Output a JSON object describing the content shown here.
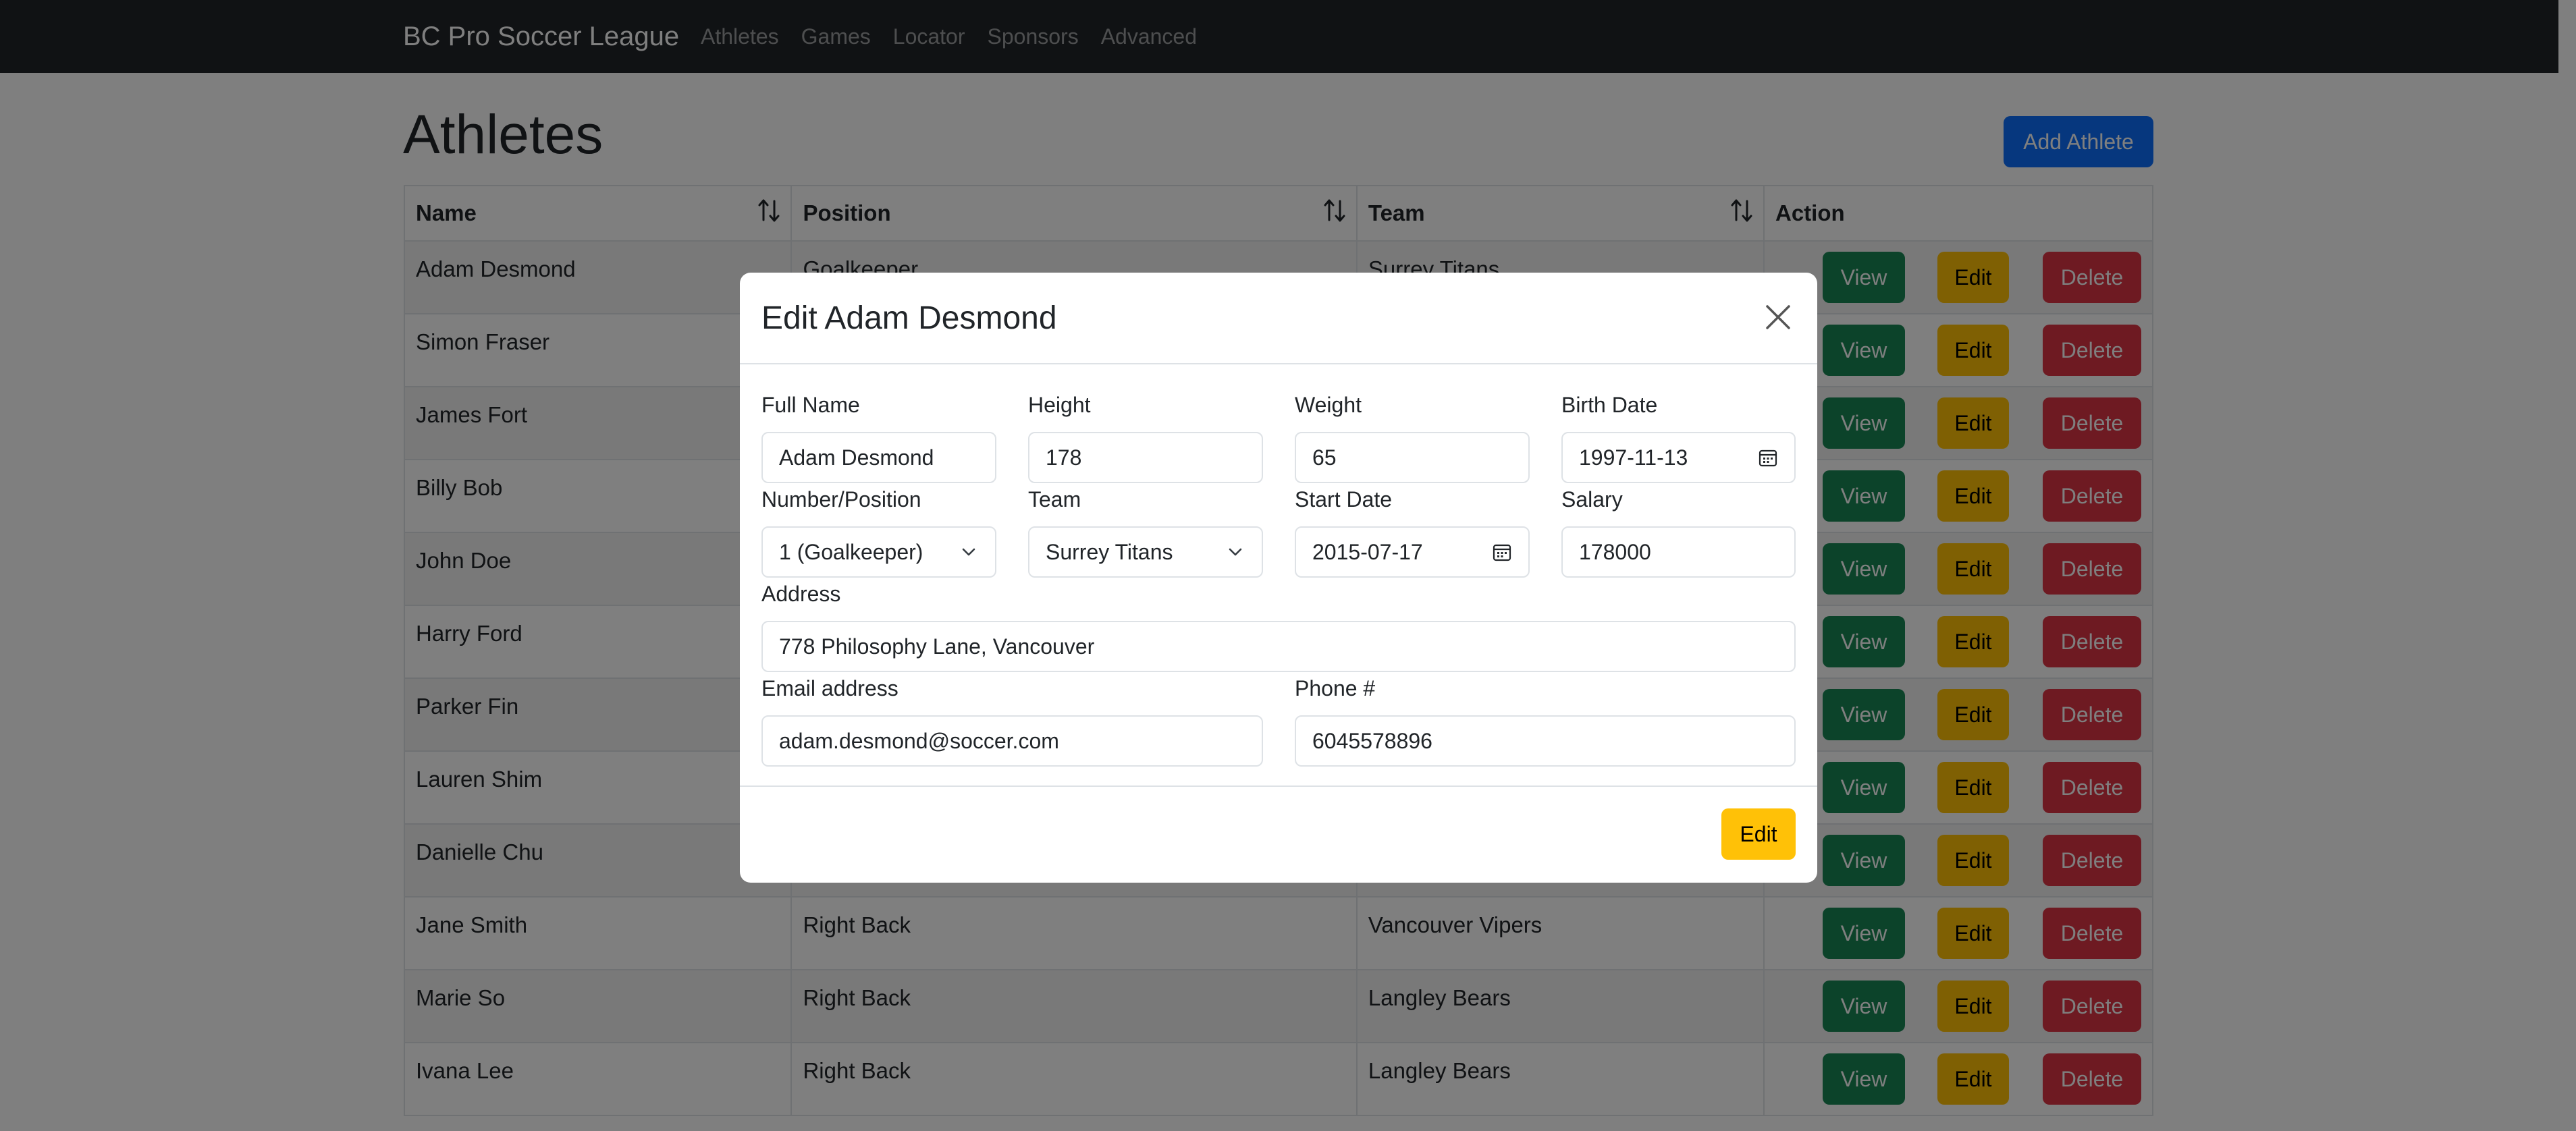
{
  "navbar": {
    "brand": "BC Pro Soccer League",
    "links": [
      "Athletes",
      "Games",
      "Locator",
      "Sponsors",
      "Advanced"
    ]
  },
  "page": {
    "title": "Athletes",
    "add_button": "Add Athlete"
  },
  "table": {
    "headers": [
      "Name",
      "Position",
      "Team",
      "Action"
    ],
    "action_labels": {
      "view": "View",
      "edit": "Edit",
      "delete": "Delete"
    },
    "rows": [
      {
        "name": "Adam Desmond",
        "position": "Goalkeeper",
        "team": "Surrey Titans"
      },
      {
        "name": "Simon Fraser",
        "position": "",
        "team": ""
      },
      {
        "name": "James Fort",
        "position": "",
        "team": ""
      },
      {
        "name": "Billy Bob",
        "position": "",
        "team": ""
      },
      {
        "name": "John Doe",
        "position": "",
        "team": ""
      },
      {
        "name": "Harry Ford",
        "position": "",
        "team": ""
      },
      {
        "name": "Parker Fin",
        "position": "",
        "team": ""
      },
      {
        "name": "Lauren Shim",
        "position": "",
        "team": ""
      },
      {
        "name": "Danielle Chu",
        "position": "",
        "team": ""
      },
      {
        "name": "Jane Smith",
        "position": "Right Back",
        "team": "Vancouver Vipers"
      },
      {
        "name": "Marie So",
        "position": "Right Back",
        "team": "Langley Bears"
      },
      {
        "name": "Ivana Lee",
        "position": "Right Back",
        "team": "Langley Bears"
      }
    ]
  },
  "modal": {
    "title": "Edit Adam Desmond",
    "fields": {
      "full_name": {
        "label": "Full Name",
        "value": "Adam Desmond"
      },
      "height": {
        "label": "Height",
        "value": "178"
      },
      "weight": {
        "label": "Weight",
        "value": "65"
      },
      "birth_date": {
        "label": "Birth Date",
        "value": "1997-11-13"
      },
      "number_position": {
        "label": "Number/Position",
        "value": "1 (Goalkeeper)"
      },
      "team": {
        "label": "Team",
        "value": "Surrey Titans"
      },
      "start_date": {
        "label": "Start Date",
        "value": "2015-07-17"
      },
      "salary": {
        "label": "Salary",
        "value": "178000"
      },
      "address": {
        "label": "Address",
        "value": "778 Philosophy Lane, Vancouver"
      },
      "email": {
        "label": "Email address",
        "value": "adam.desmond@soccer.com"
      },
      "phone": {
        "label": "Phone #",
        "value": "6045578896"
      }
    },
    "submit_label": "Edit"
  },
  "colors": {
    "navbar_bg": "#212529",
    "primary": "#0d6efd",
    "success": "#198754",
    "warning": "#ffc107",
    "danger": "#dc3545"
  },
  "icons": [
    "sort-icon",
    "close-icon",
    "calendar-icon",
    "chevron-down-icon"
  ]
}
